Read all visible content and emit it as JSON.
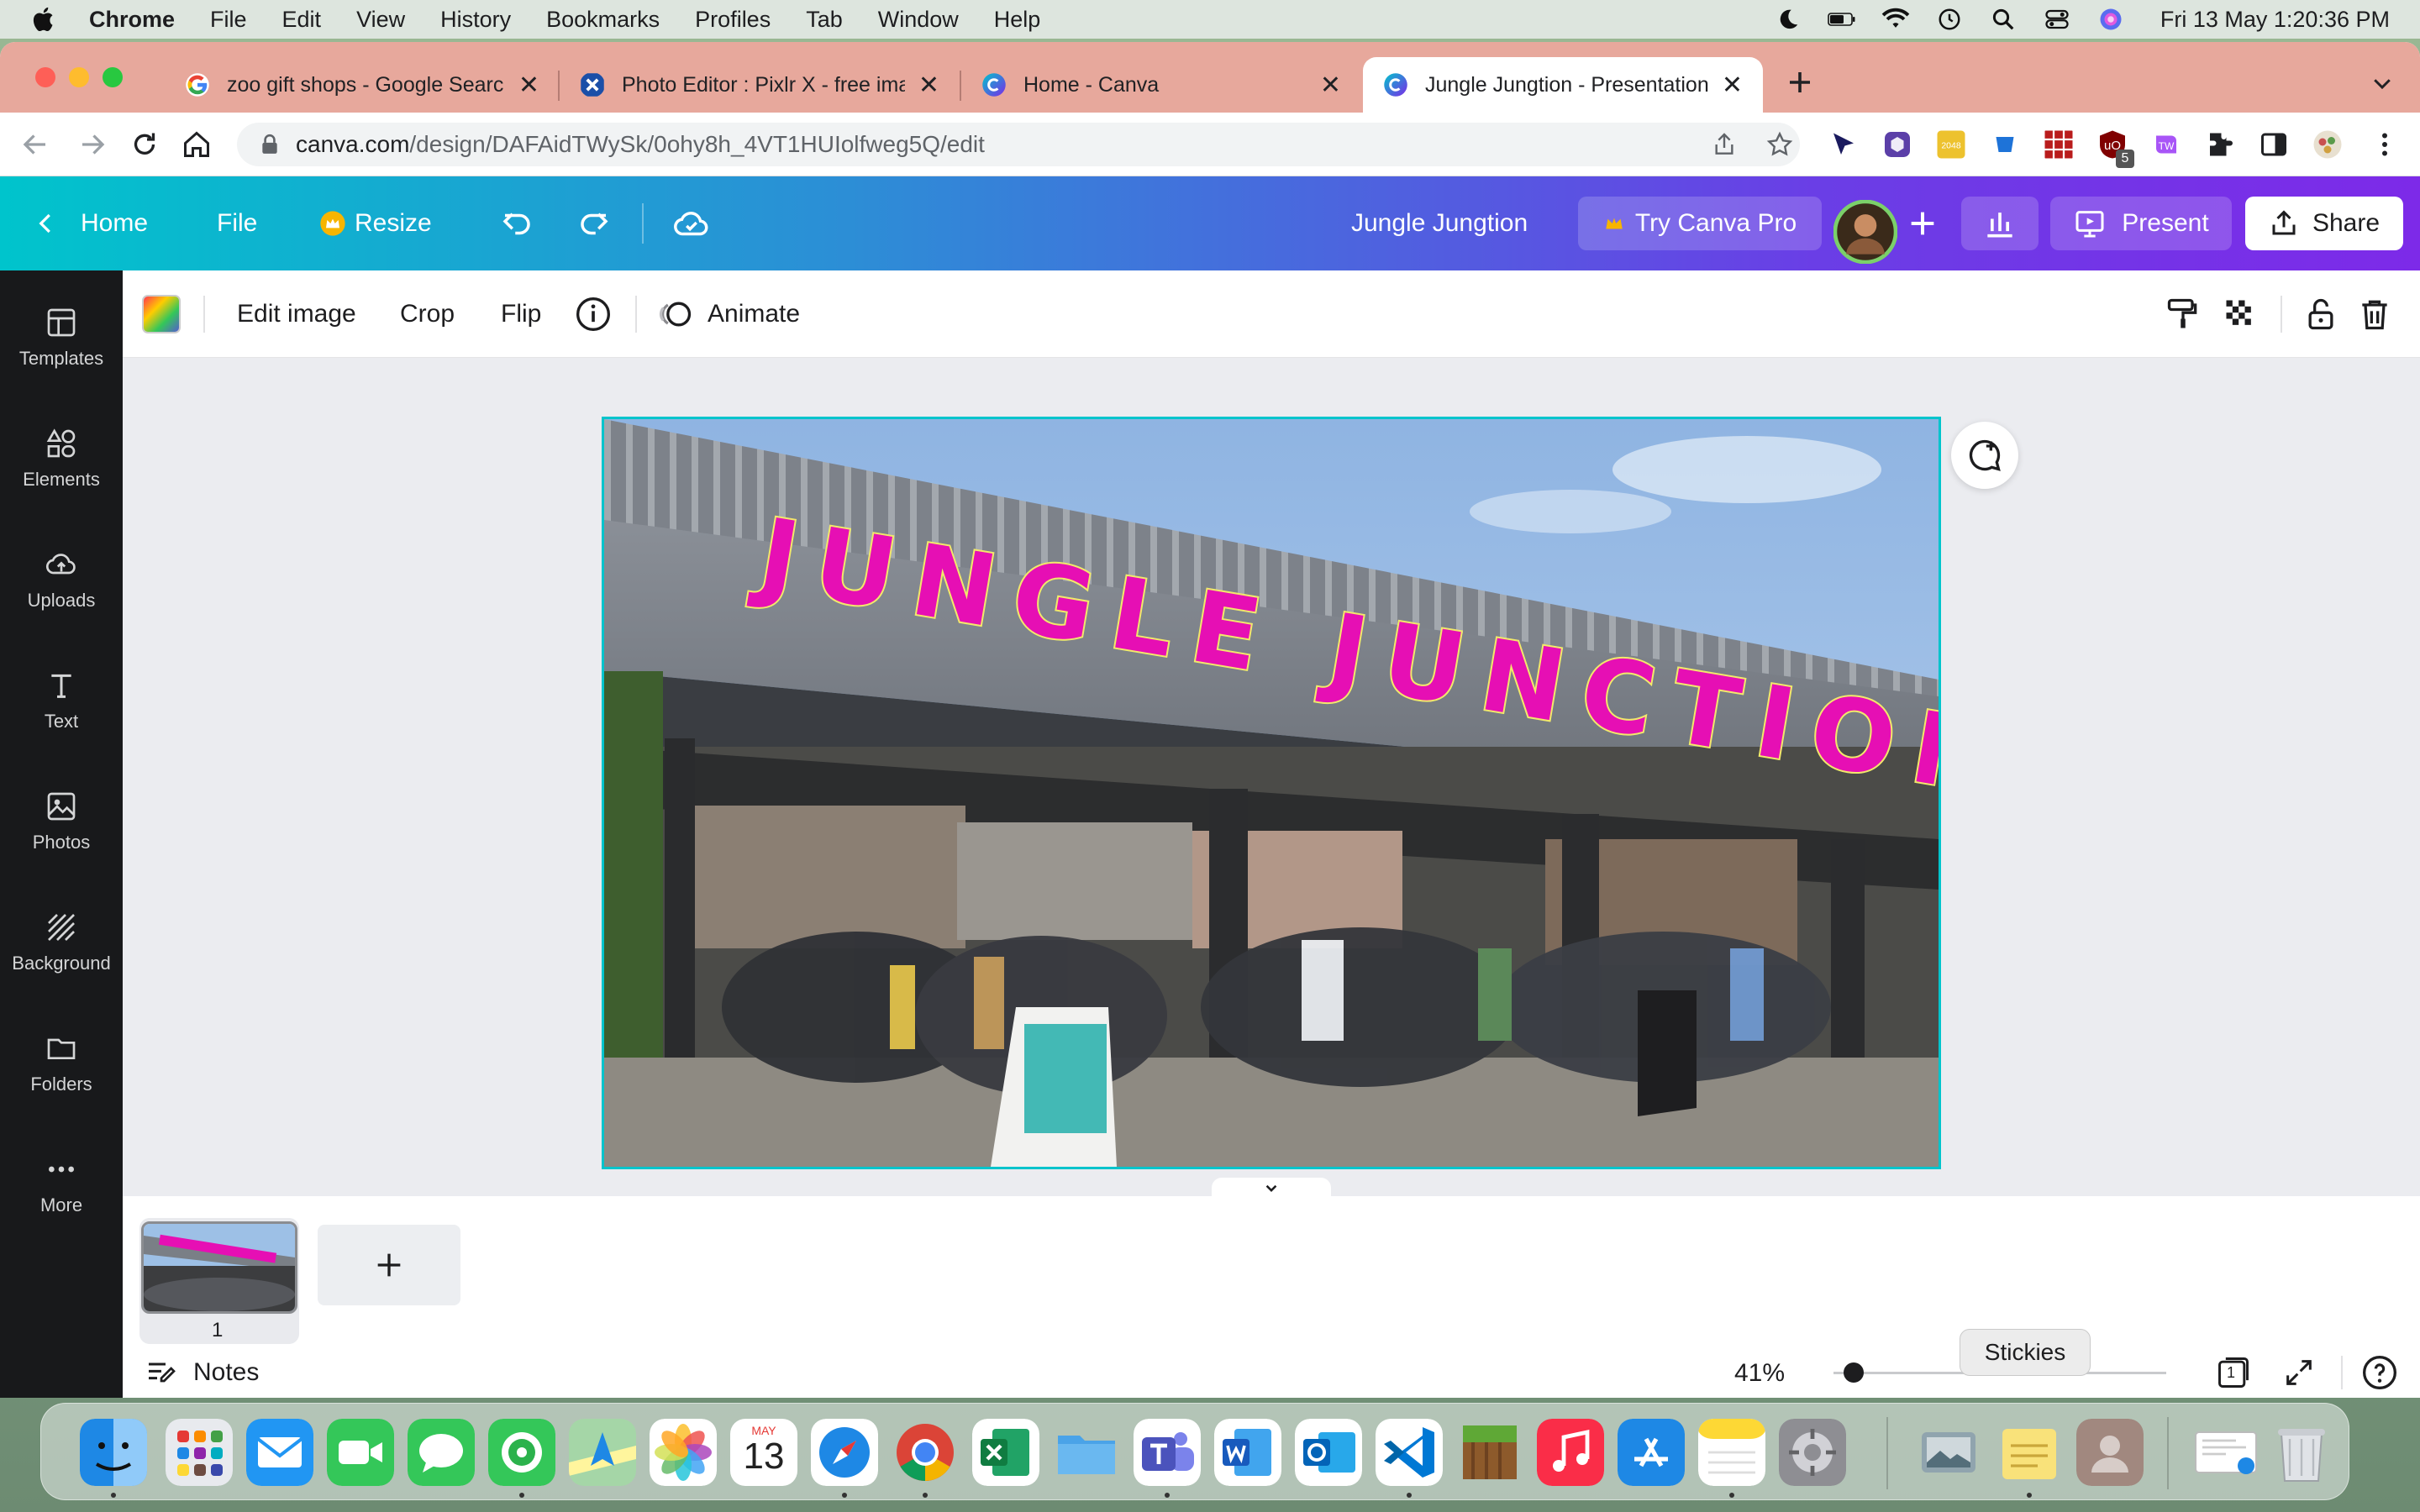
{
  "menubar": {
    "app_name": "Chrome",
    "items": [
      "File",
      "Edit",
      "View",
      "History",
      "Bookmarks",
      "Profiles",
      "Tab",
      "Window",
      "Help"
    ],
    "datetime": "Fri 13 May  1:20:36 PM"
  },
  "browser": {
    "tabs": [
      {
        "title": "zoo gift shops - Google Search",
        "favicon": "google-icon"
      },
      {
        "title": "Photo Editor : Pixlr X - free ima",
        "favicon": "pixlr-icon"
      },
      {
        "title": "Home - Canva",
        "favicon": "canva-icon"
      },
      {
        "title": "Jungle Jungtion - Presentation",
        "favicon": "canva-icon",
        "active": true
      }
    ],
    "url_domain": "canva.com",
    "url_path": "/design/DAFAidTWySk/0ohy8h_4VT1HUIolfweg5Q/edit",
    "extension_badge": "5"
  },
  "canva_header": {
    "home": "Home",
    "file": "File",
    "resize": "Resize",
    "design_title": "Jungle Jungtion",
    "try_pro": "Try Canva Pro",
    "present": "Present",
    "share": "Share"
  },
  "sidebar": {
    "items": [
      {
        "label": "Templates",
        "icon": "templates-icon"
      },
      {
        "label": "Elements",
        "icon": "elements-icon"
      },
      {
        "label": "Uploads",
        "icon": "uploads-icon"
      },
      {
        "label": "Text",
        "icon": "text-icon"
      },
      {
        "label": "Photos",
        "icon": "photos-icon"
      },
      {
        "label": "Background",
        "icon": "background-icon"
      },
      {
        "label": "Folders",
        "icon": "folders-icon"
      },
      {
        "label": "More",
        "icon": "more-icon"
      }
    ]
  },
  "toolbar": {
    "edit_image": "Edit image",
    "crop": "Crop",
    "flip": "Flip",
    "animate": "Animate"
  },
  "canvas": {
    "headline": "JUNGLE JUNCTION",
    "headline_color": "#e60fb4",
    "headline_outline": "#f2e86b",
    "selection_color": "#00c4cc"
  },
  "pages": {
    "page_number": "1"
  },
  "footer": {
    "notes": "Notes",
    "zoom": "41%",
    "zoom_fraction": 0.06,
    "page_indicator": "1"
  },
  "dock": {
    "calendar_month": "MAY",
    "calendar_day": "13",
    "tooltip": "Stickies"
  }
}
